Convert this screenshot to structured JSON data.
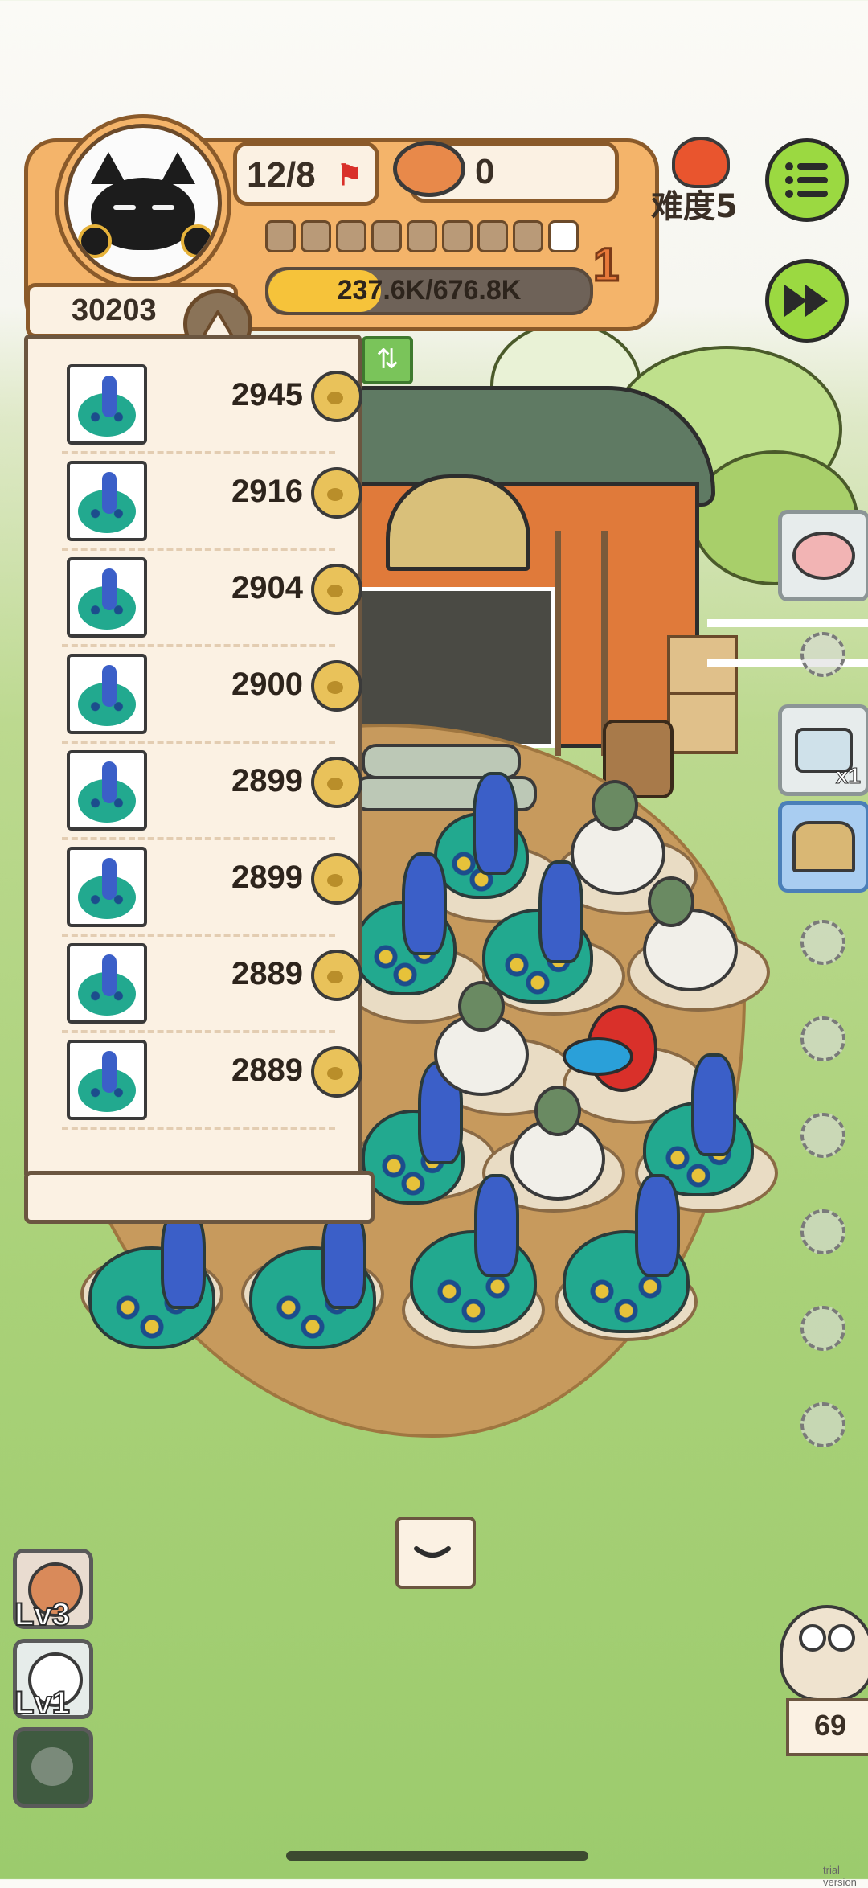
{
  "hud": {
    "population": "12/8",
    "food_count": "0",
    "difficulty_label": "难度5",
    "score": "30203",
    "xp_text": "237.6K/676.8K",
    "xp_progress_fraction": 0.35,
    "level": "1",
    "level_segments_total": 9,
    "level_segments_filled": 1
  },
  "ranking": {
    "rows": [
      {
        "animal": "peacock",
        "score": "2945"
      },
      {
        "animal": "peacock",
        "score": "2916"
      },
      {
        "animal": "peacock",
        "score": "2904"
      },
      {
        "animal": "peacock",
        "score": "2900"
      },
      {
        "animal": "peacock",
        "score": "2899"
      },
      {
        "animal": "peacock",
        "score": "2899"
      },
      {
        "animal": "peacock",
        "score": "2889"
      },
      {
        "animal": "peacock",
        "score": "2889"
      }
    ]
  },
  "side": {
    "camera_multiplier": "x1"
  },
  "skills": [
    {
      "level_label": "Lv3",
      "icon": "bird-icon"
    },
    {
      "level_label": "Lv1",
      "icon": "ghost-cat-icon"
    },
    {
      "level_label": "",
      "icon": "mouse-icon"
    }
  ],
  "owl": {
    "count": "69"
  },
  "watermark": "trial version",
  "colors": {
    "hud_orange": "#f4b46a",
    "button_green": "#9bd941",
    "panel_cream": "#fbf1e3",
    "progress_yellow": "#f6c33a"
  }
}
